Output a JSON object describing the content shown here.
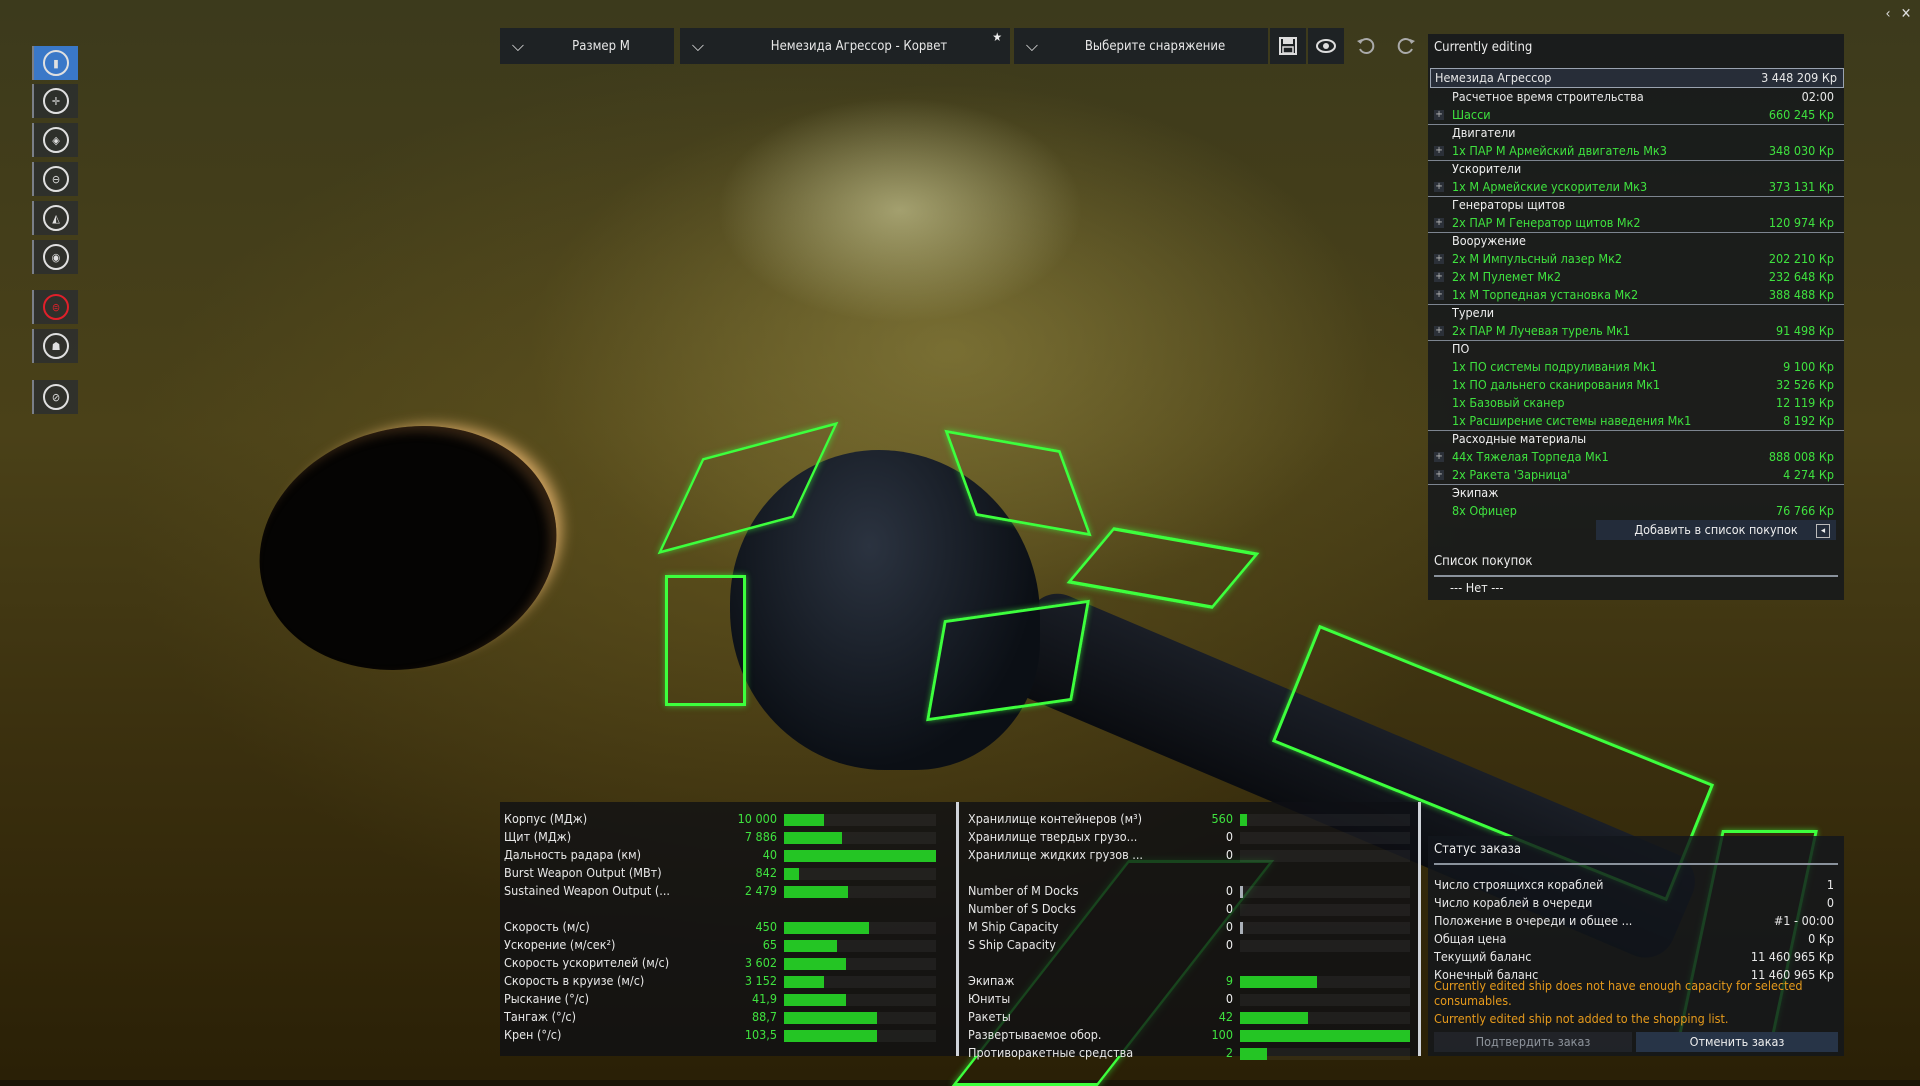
{
  "topbar": {
    "size": "Размер М",
    "ship": "Немезида Агрессор - Корвет",
    "loadout": "Выберите снаряжение",
    "star_icon": "★",
    "chevron": "⌵"
  },
  "window_controls": {
    "back": "‹",
    "close": "✕"
  },
  "toolbar_icons": [
    "save-icon",
    "eye-icon",
    "undo-icon",
    "redo-icon"
  ],
  "sidebar_icons": [
    "ship-icon",
    "engine-icon",
    "shield-icon",
    "weapon-icon",
    "turret-icon",
    "software-icon",
    "consumable-icon",
    "crew-icon",
    "paint-icon"
  ],
  "editing": {
    "header": "Currently editing",
    "ship_name": "Немезида Агрессор",
    "ship_price": "3 448 209 Кр",
    "rows": [
      {
        "type": "info",
        "name": "Расчетное время строительства",
        "value": "02:00"
      },
      {
        "type": "item",
        "name": "Шасси",
        "value": "660 245 Кр"
      },
      {
        "type": "cat",
        "name": "Двигатели",
        "value": ""
      },
      {
        "type": "item",
        "name": "1x ПАР М Армейский двигатель Мк3",
        "value": "348 030 Кр"
      },
      {
        "type": "cat",
        "name": "Ускорители",
        "value": ""
      },
      {
        "type": "item",
        "name": "1x М Армейские ускорители Мк3",
        "value": "373 131 Кр"
      },
      {
        "type": "cat",
        "name": "Генераторы щитов",
        "value": ""
      },
      {
        "type": "item",
        "name": "2x ПАР М Генератор щитов Мк2",
        "value": "120 974 Кр"
      },
      {
        "type": "cat",
        "name": "Вооружение",
        "value": ""
      },
      {
        "type": "item",
        "name": "2x М Импульсный лазер Мк2",
        "value": "202 210 Кр"
      },
      {
        "type": "item",
        "name": "2x М Пулемет Мк2",
        "value": "232 648 Кр"
      },
      {
        "type": "item",
        "name": "1x М Торпедная установка Мк2",
        "value": "388 488 Кр"
      },
      {
        "type": "cat",
        "name": "Турели",
        "value": ""
      },
      {
        "type": "item",
        "name": "2x ПАР М Лучевая турель Мк1",
        "value": "91 498 Кр"
      },
      {
        "type": "cat",
        "name": "ПО",
        "value": ""
      },
      {
        "type": "sub",
        "name": "1x ПО системы подруливания Мк1",
        "value": "9 100 Кр"
      },
      {
        "type": "sub",
        "name": "1x ПО дальнего сканирования Мк1",
        "value": "32 526 Кр"
      },
      {
        "type": "sub",
        "name": "1x Базовый сканер",
        "value": "12 119 Кр"
      },
      {
        "type": "sub",
        "name": "1x Расширение системы наведения Мк1",
        "value": "8 192 Кр"
      },
      {
        "type": "cat",
        "name": "Расходные материалы",
        "value": ""
      },
      {
        "type": "item",
        "name": "44x Тяжелая Торпеда Мк1",
        "value": "888 008 Кр"
      },
      {
        "type": "item",
        "name": "2x Ракета 'Зарница'",
        "value": "4 274 Кр"
      },
      {
        "type": "cat",
        "name": "Экипаж",
        "value": ""
      },
      {
        "type": "sub",
        "name": "8x Офицер",
        "value": "76 766 Кр"
      }
    ],
    "add_button": "Добавить в список покупок",
    "shopping_title": "Список покупок",
    "shopping_empty": "--- Нет ---"
  },
  "order": {
    "title": "Статус заказа",
    "rows": [
      {
        "name": "Число строящихся кораблей",
        "value": "1"
      },
      {
        "name": "Число кораблей в очереди",
        "value": "0"
      },
      {
        "name": "Положение в очереди и общее ...",
        "value": "#1 - 00:00"
      },
      {
        "name": "Общая цена",
        "value": "0 Кр"
      },
      {
        "name": "Текущий баланс",
        "value": "11 460 965 Кр"
      },
      {
        "name": "Конечный баланс",
        "value": "11 460 965 Кр"
      }
    ],
    "warning1": "Currently edited ship does not have enough capacity for selected consumables.",
    "warning2": "Currently edited ship not added to the shopping list.",
    "confirm": "Подтвердить заказ",
    "cancel": "Отменить заказ",
    "warning_color": "#e69a1c"
  },
  "stats_left": [
    {
      "name": "Корпус (МДж)",
      "value": "10 000",
      "fill": 0.26
    },
    {
      "name": "Щит (МДж)",
      "value": "7 886",
      "fill": 0.38
    },
    {
      "name": "Дальность радара (км)",
      "value": "40",
      "fill": 1.0
    },
    {
      "name": "Burst Weapon Output (МВт)",
      "value": "842",
      "fill": 0.1
    },
    {
      "name": "Sustained Weapon Output (...",
      "value": "2 479",
      "fill": 0.42
    },
    {
      "name": "",
      "value": "",
      "fill": 0
    },
    {
      "name": "Скорость (м/с)",
      "value": "450",
      "fill": 0.56
    },
    {
      "name": "Ускорение (м/сек²)",
      "value": "65",
      "fill": 0.35
    },
    {
      "name": "Скорость ускорителей (м/с)",
      "value": "3 602",
      "fill": 0.41
    },
    {
      "name": "Скорость в круизе (м/с)",
      "value": "3 152",
      "fill": 0.26
    },
    {
      "name": "Рыскание (°/с)",
      "value": "41,9",
      "fill": 0.41
    },
    {
      "name": "Тангаж (°/с)",
      "value": "88,7",
      "fill": 0.61
    },
    {
      "name": "Крен (°/с)",
      "value": "103,5",
      "fill": 0.61
    }
  ],
  "stats_right": [
    {
      "name": "Хранилище контейнеров (м³)",
      "value": "560",
      "fill": 0.04,
      "green": true
    },
    {
      "name": "Хранилище твердых грузо...",
      "value": "0",
      "fill": 0,
      "green": false
    },
    {
      "name": "Хранилище жидких грузов ...",
      "value": "0",
      "fill": 0,
      "green": false
    },
    {
      "name": "",
      "value": "",
      "fill": 0,
      "green": false
    },
    {
      "name": "Number of M Docks",
      "value": "0",
      "fill": 0.02,
      "green": false
    },
    {
      "name": "Number of S Docks",
      "value": "0",
      "fill": 0,
      "green": false
    },
    {
      "name": "M Ship Capacity",
      "value": "0",
      "fill": 0.02,
      "green": false
    },
    {
      "name": "S Ship Capacity",
      "value": "0",
      "fill": 0,
      "green": false
    },
    {
      "name": "",
      "value": "",
      "fill": 0,
      "green": false
    },
    {
      "name": "Экипаж",
      "value": "9",
      "fill": 0.45,
      "green": true
    },
    {
      "name": "Юниты",
      "value": "0",
      "fill": 0,
      "green": false
    },
    {
      "name": "Ракеты",
      "value": "42",
      "fill": 0.4,
      "green": true
    },
    {
      "name": "Развертываемое обор.",
      "value": "100",
      "fill": 1.0,
      "green": true
    },
    {
      "name": "Противоракетные средства",
      "value": "2",
      "fill": 0.16,
      "green": true
    }
  ]
}
